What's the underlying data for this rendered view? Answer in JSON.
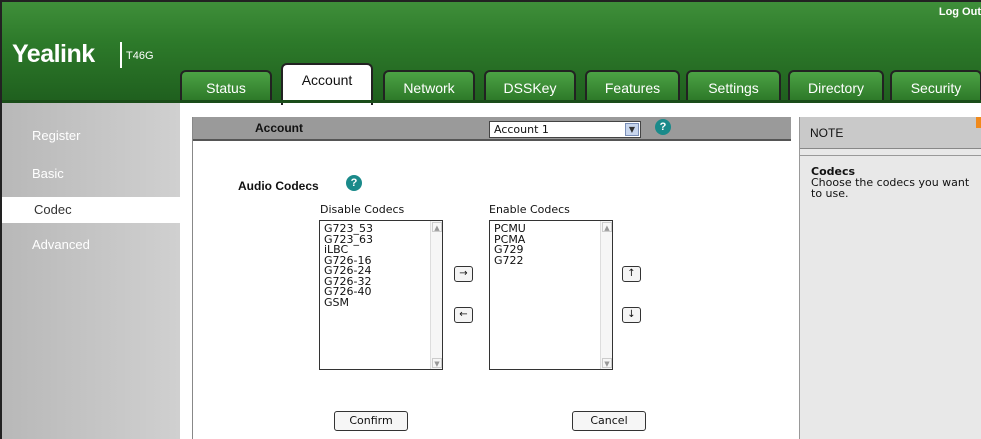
{
  "header": {
    "brand": "Yealink",
    "model": "T46G",
    "logout": "Log Out"
  },
  "tabs": [
    {
      "label": "Status"
    },
    {
      "label": "Account"
    },
    {
      "label": "Network"
    },
    {
      "label": "DSSKey"
    },
    {
      "label": "Features"
    },
    {
      "label": "Settings"
    },
    {
      "label": "Directory"
    },
    {
      "label": "Security"
    }
  ],
  "active_tab": "Account",
  "sidebar": {
    "items": [
      {
        "label": "Register"
      },
      {
        "label": "Basic"
      },
      {
        "label": "Codec"
      },
      {
        "label": "Advanced"
      }
    ],
    "active": "Codec"
  },
  "main": {
    "bar_label": "Account",
    "account_select": "Account 1",
    "help_glyph": "?",
    "section_title": "Audio Codecs",
    "disable_label": "Disable Codecs",
    "enable_label": "Enable Codecs",
    "disable_codecs": [
      "G723_53",
      "G723_63",
      "iLBC",
      "G726-16",
      "G726-24",
      "G726-32",
      "G726-40",
      "GSM"
    ],
    "enable_codecs": [
      "PCMU",
      "PCMA",
      "G729",
      "G722"
    ],
    "move_right": "→",
    "move_left": "←",
    "move_up": "↑",
    "move_down": "↓",
    "confirm": "Confirm",
    "cancel": "Cancel"
  },
  "note": {
    "header": "NOTE",
    "title": "Codecs",
    "body": "Choose the codecs you want to use."
  },
  "colors": {
    "header_green": "#2d7a2a",
    "accent_orange": "#f08a1c",
    "help_teal": "#1a8a8a"
  }
}
